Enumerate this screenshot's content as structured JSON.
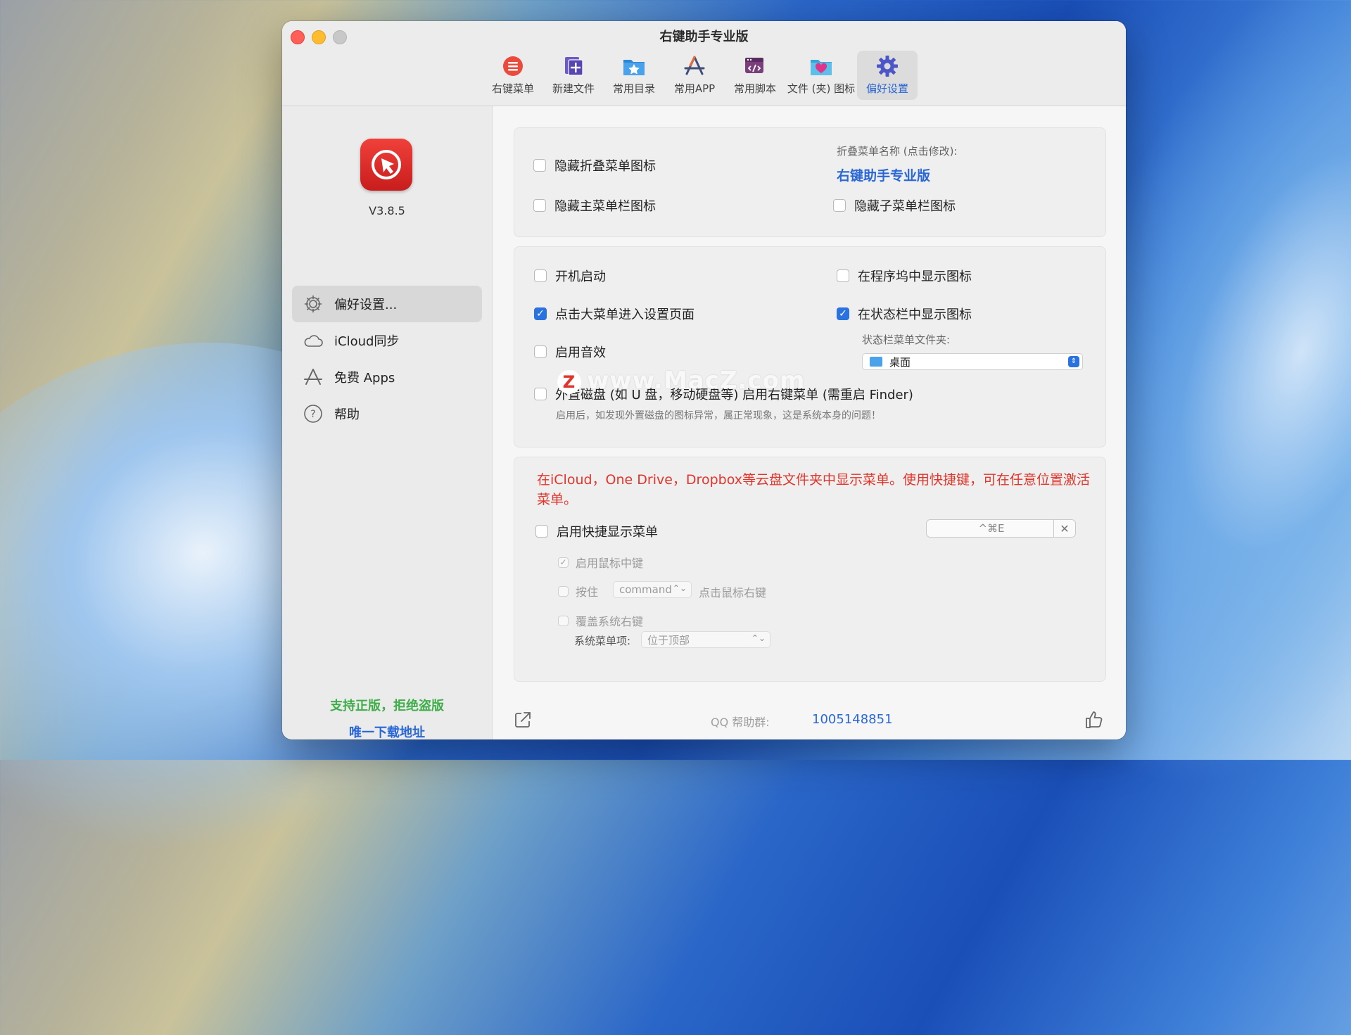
{
  "window": {
    "title": "右键助手专业版"
  },
  "toolbar": {
    "items": [
      {
        "label": "右键菜单",
        "icon": "menu-list-icon"
      },
      {
        "label": "新建文件",
        "icon": "new-file-icon"
      },
      {
        "label": "常用目录",
        "icon": "folder-star-icon"
      },
      {
        "label": "常用APP",
        "icon": "app-store-icon"
      },
      {
        "label": "常用脚本",
        "icon": "script-icon"
      },
      {
        "label": "文件 (夹) 图标",
        "icon": "folder-heart-icon"
      },
      {
        "label": "偏好设置",
        "icon": "gear-icon",
        "active": true
      }
    ]
  },
  "sidebar": {
    "version": "V3.8.5",
    "items": [
      {
        "label": "偏好设置...",
        "icon": "gear-icon",
        "active": true
      },
      {
        "label": "iCloud同步",
        "icon": "cloud-icon"
      },
      {
        "label": "免费 Apps",
        "icon": "app-store-icon"
      },
      {
        "label": "帮助",
        "icon": "help-icon"
      }
    ],
    "footer_slogan": "支持正版，拒绝盗版",
    "footer_link": "唯一下载地址"
  },
  "panel1": {
    "hide_fold_icon": "隐藏折叠菜单图标",
    "hide_main_icon": "隐藏主菜单栏图标",
    "fold_name_label": "折叠菜单名称 (点击修改):",
    "fold_name_value": "右键助手专业版",
    "hide_sub_icon": "隐藏子菜单栏图标"
  },
  "panel2": {
    "launch_at_login": "开机启动",
    "show_in_dock": "在程序坞中显示图标",
    "click_menu_settings": "点击大菜单进入设置页面",
    "show_in_statusbar": "在状态栏中显示图标",
    "statusbar_folder_label": "状态栏菜单文件夹:",
    "statusbar_folder_value": "桌面",
    "enable_sound": "启用音效",
    "external_disk": "外置磁盘 (如 U 盘，移动硬盘等) 启用右键菜单 (需重启 Finder)",
    "external_disk_note": "启用后，如发现外置磁盘的图标异常，属正常现象，这是系统本身的问题！"
  },
  "panel3": {
    "notice": "在iCloud，One Drive，Dropbox等云盘文件夹中显示菜单。使用快捷键，可在任意位置激活菜单。",
    "enable_shortcut": "启用快捷显示菜单",
    "shortcut_value": "^⌘E",
    "mouse_middle": "启用鼠标中键",
    "hold": "按住",
    "hold_key": "command",
    "click_right": "点击鼠标右键",
    "override_system": "覆盖系统右键",
    "system_menu_label": "系统菜单项:",
    "system_menu_value": "位于顶部"
  },
  "bottom": {
    "qq_label": "QQ 帮助群:",
    "qq_number": "1005148851"
  },
  "watermark": "www.MacZ.com",
  "colors": {
    "accent": "#2a67d6",
    "red": "#e0352b",
    "green": "#3fae4a"
  }
}
